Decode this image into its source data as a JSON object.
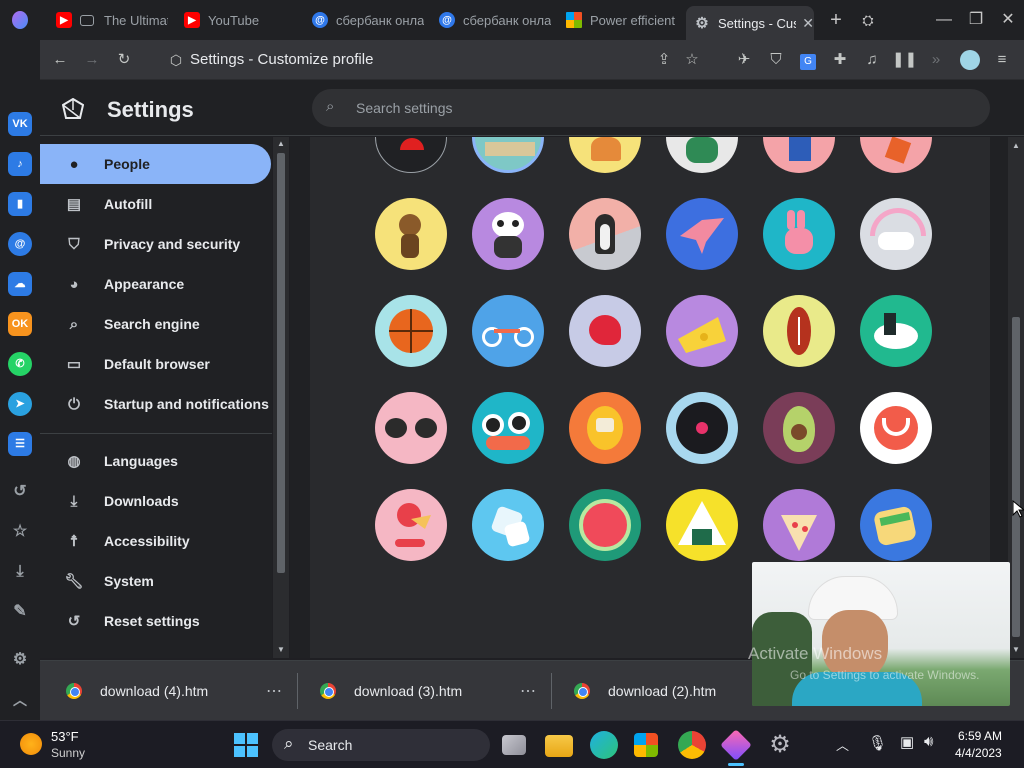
{
  "tabs": [
    {
      "label": "The Ultimat",
      "icon": "youtube-icon",
      "active": false
    },
    {
      "label": "YouTube",
      "icon": "youtube-icon",
      "active": false
    },
    {
      "label": "сбербанк онла",
      "icon": "mail-icon",
      "active": false
    },
    {
      "label": "сбербанк онла",
      "icon": "mail-icon",
      "active": false
    },
    {
      "label": "Power efficient",
      "icon": "microsoft-icon",
      "active": false
    },
    {
      "label": "Settings - Custo",
      "icon": "gear-icon",
      "active": true
    }
  ],
  "toolbar": {
    "page_title": "Settings - Customize profile"
  },
  "settings": {
    "title": "Settings",
    "search_placeholder": "Search settings",
    "nav": [
      {
        "label": "People",
        "icon": "person-icon",
        "active": true
      },
      {
        "label": "Autofill",
        "icon": "clipboard-icon",
        "active": false
      },
      {
        "label": "Privacy and security",
        "icon": "shield-icon",
        "active": false
      },
      {
        "label": "Appearance",
        "icon": "palette-icon",
        "active": false
      },
      {
        "label": "Search engine",
        "icon": "search-icon",
        "active": false
      },
      {
        "label": "Default browser",
        "icon": "browser-icon",
        "active": false
      },
      {
        "label": "Startup and notifications",
        "icon": "power-icon",
        "active": false
      }
    ],
    "nav2": [
      {
        "label": "Languages",
        "icon": "globe-icon"
      },
      {
        "label": "Downloads",
        "icon": "download-icon"
      },
      {
        "label": "Accessibility",
        "icon": "accessibility-icon"
      },
      {
        "label": "System",
        "icon": "wrench-icon"
      },
      {
        "label": "Reset settings",
        "icon": "history-icon"
      }
    ]
  },
  "avatars": [
    {
      "name": "red-cap-avatar",
      "bg": "#202124"
    },
    {
      "name": "landscape-avatar",
      "bg": "#7ec8c6"
    },
    {
      "name": "fox-avatar",
      "bg": "#f6e27a"
    },
    {
      "name": "plant-avatar",
      "bg": "#e8e8e8"
    },
    {
      "name": "blue-bird-avatar",
      "bg": "#f4a3a8"
    },
    {
      "name": "orange-fox-avatar",
      "bg": "#f4a3a8"
    },
    {
      "name": "monkey-avatar",
      "bg": "#f6e27a"
    },
    {
      "name": "panda-avatar",
      "bg": "#b889e0"
    },
    {
      "name": "penguin-avatar",
      "bg": "#f2b0a8"
    },
    {
      "name": "butterfly-avatar",
      "bg": "#3d6fe0"
    },
    {
      "name": "rabbit-avatar",
      "bg": "#1fb6c8"
    },
    {
      "name": "unicorn-avatar",
      "bg": "#dadde3"
    },
    {
      "name": "basketball-avatar",
      "bg": "#a8e3e8"
    },
    {
      "name": "bicycle-avatar",
      "bg": "#4fa3e8"
    },
    {
      "name": "red-bird-avatar",
      "bg": "#c7cbe6"
    },
    {
      "name": "cheese-avatar",
      "bg": "#b889e0"
    },
    {
      "name": "football-avatar",
      "bg": "#e9ea8a"
    },
    {
      "name": "sushi-bowl-avatar",
      "bg": "#21b98f"
    },
    {
      "name": "sunglasses-avatar",
      "bg": "#f5b7c4"
    },
    {
      "name": "sushi-avatar",
      "bg": "#1fb6c8"
    },
    {
      "name": "tamagotchi-avatar",
      "bg": "#f47a3a"
    },
    {
      "name": "vinyl-avatar",
      "bg": "#a8d8ef"
    },
    {
      "name": "avocado-avatar",
      "bg": "#7a3d58"
    },
    {
      "name": "smile-avatar",
      "bg": "#ffffff"
    },
    {
      "name": "ice-cream-avatar",
      "bg": "#f5b7c4"
    },
    {
      "name": "dice-avatar",
      "bg": "#5ec7f0"
    },
    {
      "name": "watermelon-avatar",
      "bg": "#1f9a78"
    },
    {
      "name": "onigiri-avatar",
      "bg": "#f6e12a"
    },
    {
      "name": "pizza-avatar",
      "bg": "#b07ad8"
    },
    {
      "name": "sandwich-avatar",
      "bg": "#3a78e0"
    }
  ],
  "downloads": [
    {
      "label": "download (4).htm"
    },
    {
      "label": "download (3).htm"
    },
    {
      "label": "download (2).htm"
    }
  ],
  "overlay": {
    "watermark_line1": "Activate Windows",
    "watermark_line2": "Go to Settings to activate Windows."
  },
  "taskbar": {
    "weather_temp": "53°F",
    "weather_cond": "Sunny",
    "search_label": "Search",
    "time": "6:59 AM",
    "date": "4/4/2023"
  }
}
